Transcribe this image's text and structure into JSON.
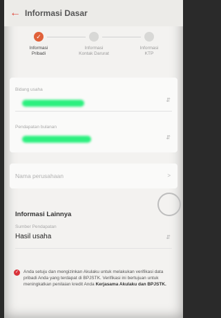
{
  "header": {
    "title": "Informasi Dasar"
  },
  "stepper": {
    "steps": [
      {
        "label_line1": "Informasi",
        "label_line2": "Pribadi",
        "active": true
      },
      {
        "label_line1": "Informasi",
        "label_line2": "Kontak Darurat",
        "active": false
      },
      {
        "label_line1": "Informasi",
        "label_line2": "KTP",
        "active": false
      }
    ]
  },
  "fields": {
    "bidang_usaha": {
      "label": "Bidang usaha"
    },
    "pendapatan": {
      "label": "Pendapatan bulanan"
    },
    "nama_perusahaan": {
      "placeholder": "Nama perusahaan"
    }
  },
  "other_info": {
    "title": "Informasi Lainnya",
    "sumber_label": "Sumber Pendapatan",
    "sumber_value": "Hasil usaha"
  },
  "consent": {
    "text_prefix": "Anda setuju dan mengizinkan Akulaku untuk melakukan verifikasi data pribadi Anda yang terdapat di BPJSTK. Verifikasi ini bertujuan untuk meningkatkan penilaian kredit Anda ",
    "text_bold": "Kerjasama Akulaku dan BPJSTK."
  },
  "colors": {
    "accent": "#e0613a",
    "check": "#d9323a",
    "background": "#f3f2f0"
  }
}
